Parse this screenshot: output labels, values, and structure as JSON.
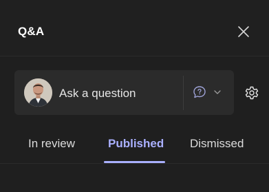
{
  "header": {
    "title": "Q&A"
  },
  "ask": {
    "placeholder": "Ask a question"
  },
  "tabs": [
    {
      "label": "In review",
      "active": false
    },
    {
      "label": "Published",
      "active": true
    },
    {
      "label": "Dismissed",
      "active": false
    }
  ],
  "colors": {
    "background": "#1f1f1f",
    "input_bg": "#2b2b2b",
    "accent": "#aab0ff"
  },
  "icons": {
    "close": "close-icon",
    "settings": "gear-icon",
    "question_type": "question-bubble-icon",
    "dropdown": "chevron-down-icon"
  }
}
